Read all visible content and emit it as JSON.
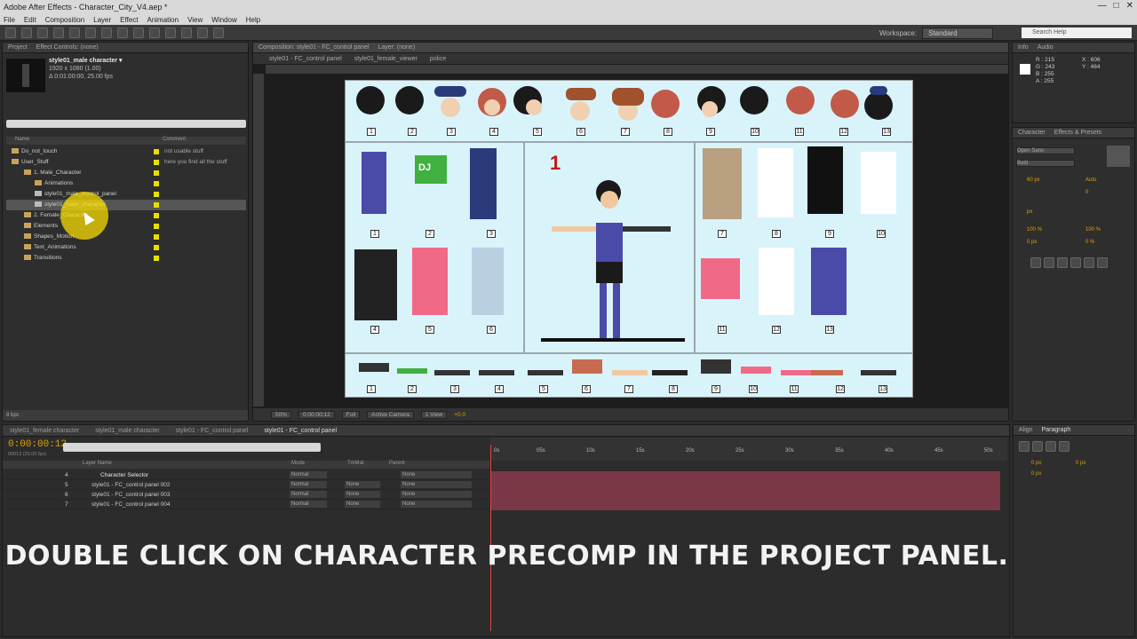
{
  "window": {
    "title": "Adobe After Effects - Character_City_V4.aep *"
  },
  "menu": [
    "File",
    "Edit",
    "Composition",
    "Layer",
    "Effect",
    "Animation",
    "View",
    "Window",
    "Help"
  ],
  "toolbar": {
    "workspace_label": "Workspace:",
    "workspace_value": "Standard",
    "search_placeholder": "Search Help"
  },
  "project": {
    "tab_project": "Project",
    "tab_effects": "Effect Controls: (none)",
    "selected_name": "style01_male character ▾",
    "selected_info1": "1920 x 1080 (1.00)",
    "selected_info2": "Δ 0:01:00:00, 25.00 fps",
    "col_name": "Name",
    "col_comment": "Comment",
    "items": [
      {
        "label": "Do_not_touch",
        "comment": "not usable stuff"
      },
      {
        "label": "User_Stuff",
        "comment": "here you find all the stuff"
      },
      {
        "label": "1. Male_Character",
        "comment": ""
      },
      {
        "label": "Animations",
        "comment": ""
      },
      {
        "label": "style01_male_control_panel",
        "comment": ""
      },
      {
        "label": "style01_male_character",
        "comment": ""
      },
      {
        "label": "2. Female_Character",
        "comment": ""
      },
      {
        "label": "Elements",
        "comment": ""
      },
      {
        "label": "Shapes_Motion",
        "comment": ""
      },
      {
        "label": "Text_Animations",
        "comment": ""
      },
      {
        "label": "Transitions",
        "comment": ""
      }
    ],
    "footer_bpc": "8 bpc"
  },
  "composition": {
    "tab_label": "Composition: style01 - FC_control panel",
    "layer_tab": "Layer: (none)",
    "flow": [
      "style01 - FC_control panel",
      "style01_female_viewer",
      "police"
    ],
    "footer": {
      "zoom": "50%",
      "time": "0:00:00:12",
      "resolution": "Full",
      "camera": "Active Camera",
      "views": "1 View",
      "exposure": "+0.0"
    },
    "canvas": {
      "big_number": "1",
      "hair_numbers": [
        "1",
        "2",
        "3",
        "4",
        "5",
        "6",
        "7",
        "8",
        "9",
        "10",
        "11",
        "12",
        "13"
      ],
      "top_left_numbers": [
        "1",
        "2",
        "3",
        "4",
        "5",
        "6"
      ],
      "top_right_numbers": [
        "7",
        "8",
        "9",
        "10",
        "11",
        "12",
        "13"
      ],
      "shoe_numbers": [
        "1",
        "2",
        "3",
        "4",
        "5",
        "6",
        "7",
        "8",
        "9",
        "10",
        "11",
        "12",
        "13"
      ],
      "badge_text": "DJ"
    }
  },
  "info_panel": {
    "tab_info": "Info",
    "tab_audio": "Audio",
    "r": "R : 215",
    "g": "G : 243",
    "b": "B : 255",
    "a": "A : 255",
    "x": "X : 606",
    "y": "Y : 484"
  },
  "character_panel": {
    "tab_character": "Character",
    "tab_effects_presets": "Effects & Presets",
    "font": "Open Sans",
    "style": "Bold",
    "size": "60 px",
    "leading": "Auto",
    "tracking": "0",
    "unit": "px",
    "vscale": "100 %",
    "hscale": "100 %",
    "baseline": "0 px",
    "tsume": "0 %"
  },
  "timeline": {
    "tabs": [
      "style01_female character",
      "style01_male character",
      "style01 - FC_control panel",
      "style01 - FC_control panel"
    ],
    "timecode": "0:00:00:12",
    "timecode_sub": "00012 (25.00 fps)",
    "col_layer": "Layer Name",
    "col_mode": "Mode",
    "col_trkmat": "TrkMat",
    "col_parent": "Parent",
    "layers": [
      {
        "num": "4",
        "name": "Character Selector",
        "mode": "Normal",
        "trk": "",
        "parent": "None"
      },
      {
        "num": "5",
        "name": "style01 - FC_control panel 002",
        "mode": "Normal",
        "trk": "None",
        "parent": "None"
      },
      {
        "num": "6",
        "name": "style01 - FC_control panel 003",
        "mode": "Normal",
        "trk": "None",
        "parent": "None"
      },
      {
        "num": "7",
        "name": "style01 - FC_control panel 004",
        "mode": "Normal",
        "trk": "None",
        "parent": "None"
      }
    ],
    "ruler_ticks": [
      "0s",
      "05s",
      "10s",
      "15s",
      "20s",
      "25s",
      "30s",
      "35s",
      "40s",
      "45s",
      "50s"
    ],
    "caption": "DOUBLE CLICK ON CHARACTER PRECOMP IN THE PROJECT PANEL."
  },
  "right_bottom": {
    "tab_align": "Align",
    "tab_paragraph": "Paragraph",
    "indent1": "0 px",
    "indent2": "0 px",
    "indent3": "0 px"
  }
}
